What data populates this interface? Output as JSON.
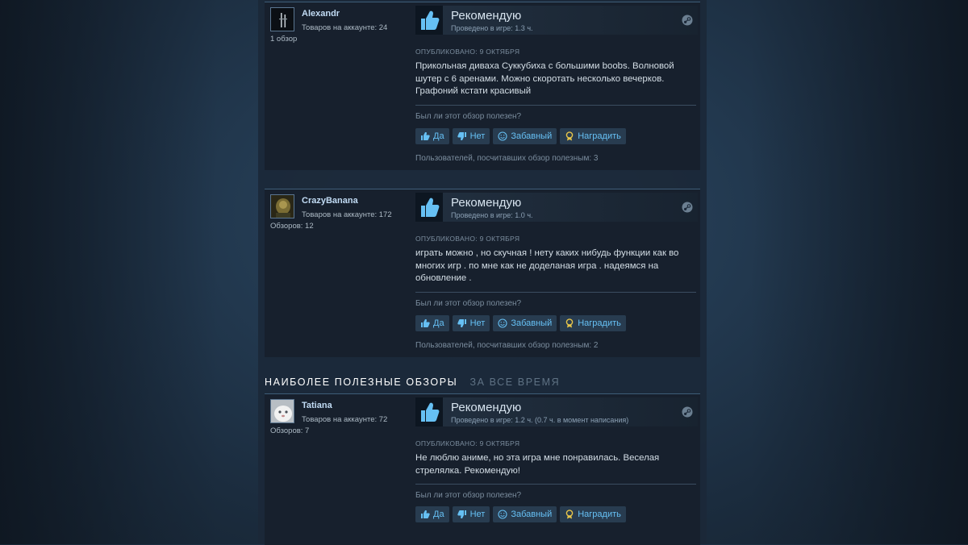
{
  "section": {
    "title": "НАИБОЛЕЕ ПОЛЕЗНЫЕ ОБЗОРЫ",
    "subtitle": "ЗА ВСЕ ВРЕМЯ"
  },
  "reviews": [
    {
      "author": "Alexandr",
      "products": "Товаров на аккаунте: 24",
      "review_count": "1 обзор",
      "verdict": "Рекомендую",
      "hours": "Проведено в игре: 1.3 ч.",
      "posted": "ОПУБЛИКОВАНО: 9 ОКТЯБРЯ",
      "text": "Прикольная диваха Суккубиха с большими boobs. Волновой шутер с 6 аренами. Можно скоротать несколько вечерков. Графоний кстати красивый",
      "helpful_question": "Был ли этот обзор полезен?",
      "helpful_count": "Пользователей, посчитавших обзор полезным: 3"
    },
    {
      "author": "CrazyBanana",
      "products": "Товаров на аккаунте: 172",
      "review_count": "Обзоров: 12",
      "verdict": "Рекомендую",
      "hours": "Проведено в игре: 1.0 ч.",
      "posted": "ОПУБЛИКОВАНО: 9 ОКТЯБРЯ",
      "text": "играть можно , но скучная ! нету каких нибудь функции как во многих игр . по мне как не доделаная игра . надеямся на обновление .",
      "helpful_question": "Был ли этот обзор полезен?",
      "helpful_count": "Пользователей, посчитавших обзор полезным: 2"
    },
    {
      "author": "Tatiana",
      "products": "Товаров на аккаунте: 72",
      "review_count": "Обзоров: 7",
      "verdict": "Рекомендую",
      "hours": "Проведено в игре: 1.2 ч. (0.7 ч. в момент написания)",
      "posted": "ОПУБЛИКОВАНО: 9 ОКТЯБРЯ",
      "text": "Не люблю аниме, но эта игра мне понравилась. Веселая стрелялка. Рекомендую!",
      "helpful_question": "Был ли этот обзор полезен?"
    }
  ],
  "buttons": {
    "yes": "Да",
    "no": "Нет",
    "funny": "Забавный",
    "award": "Наградить"
  },
  "colors": {
    "accent": "#66c0f4",
    "username": "#c1dbf4",
    "thumb": "#66c0f4",
    "award": "#e8c64a"
  },
  "icons": {
    "verdict": "thumbs-up-icon",
    "platform": "steam-icon",
    "yes": "thumbs-up-icon",
    "no": "thumbs-down-icon",
    "funny": "smiley-icon",
    "award": "award-ribbon-icon"
  }
}
